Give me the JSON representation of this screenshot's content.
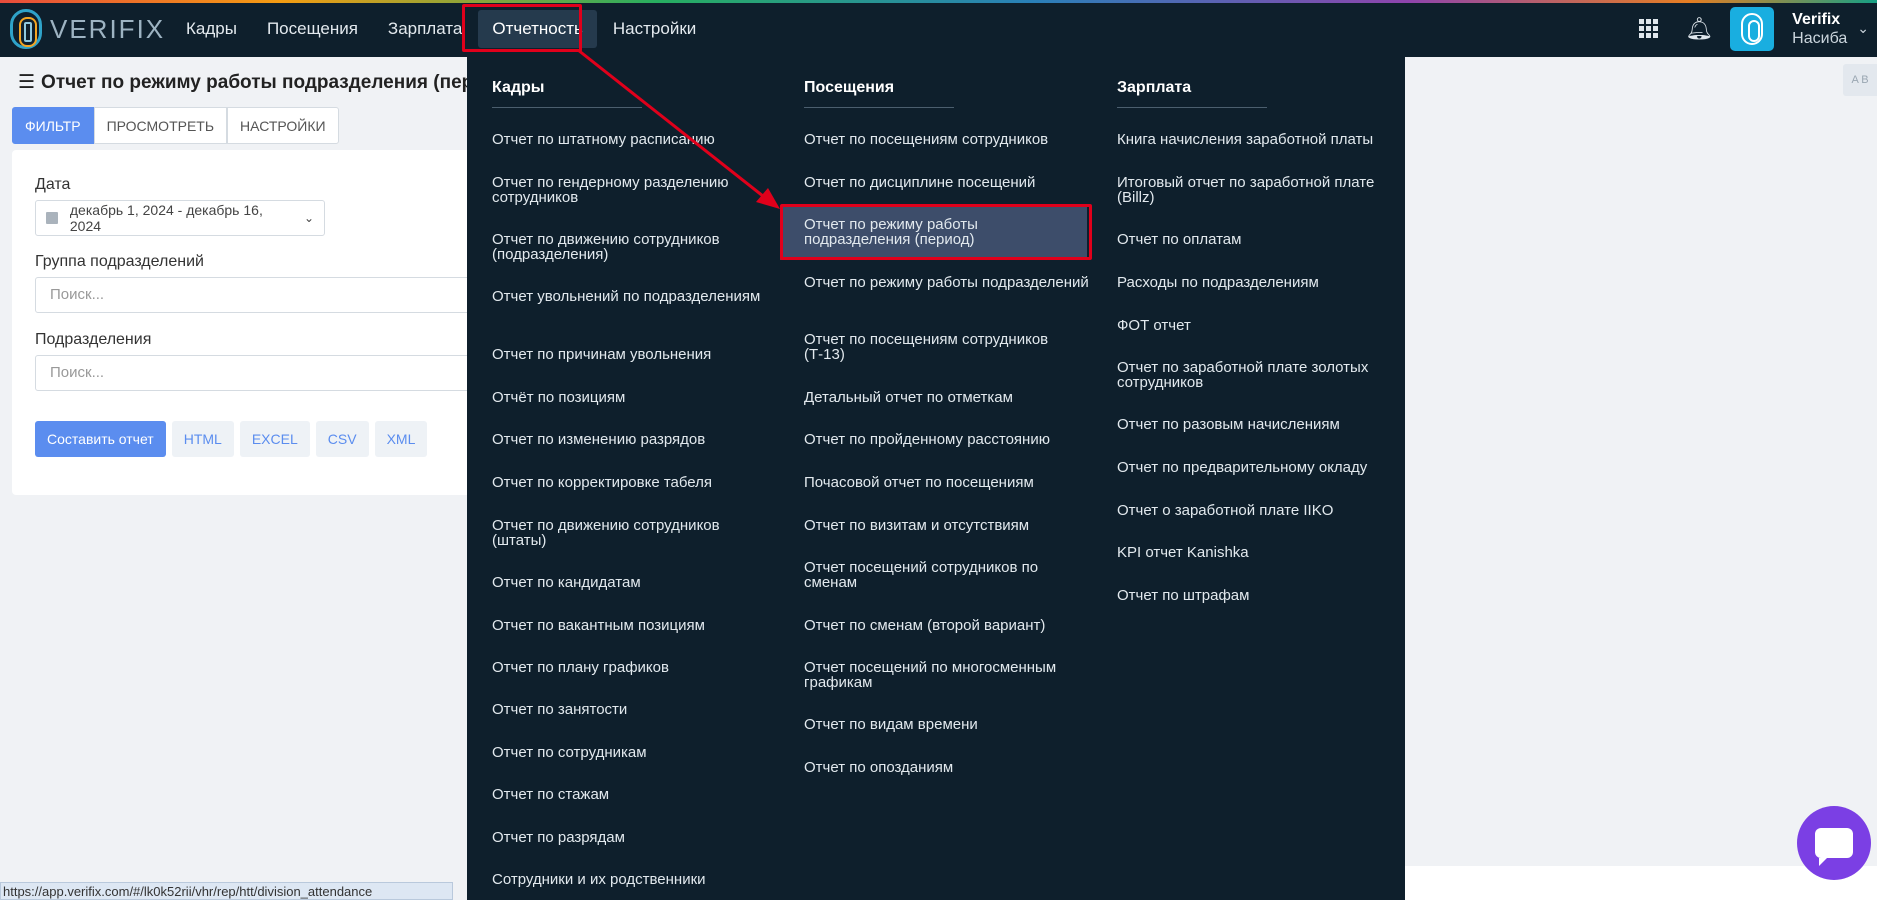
{
  "header": {
    "logo_text": "VERIFIX",
    "nav": [
      "Кадры",
      "Посещения",
      "Зарплата",
      "Отчетность",
      "Настройки"
    ],
    "user_name": "Verifix",
    "user_sub": "Насиба"
  },
  "page": {
    "title": "Отчет по режиму работы подразделения (перио",
    "tabs": [
      "ФИЛЬТР",
      "ПРОСМОТРЕТЬ",
      "НАСТРОЙКИ"
    ],
    "side_tag": "A B"
  },
  "filter": {
    "date_label": "Дата",
    "date_value": "декабрь 1, 2024 - декабрь 16, 2024",
    "group_label": "Группа подразделений",
    "group_placeholder": "Поиск...",
    "division_label": "Подразделения",
    "division_placeholder": "Поиск...",
    "buttons": [
      "Составить отчет",
      "HTML",
      "EXCEL",
      "CSV",
      "XML"
    ]
  },
  "menu": {
    "columns": [
      {
        "title": "Кадры",
        "items": [
          "Отчет по штатному расписанию",
          "Отчет по гендерному разделению сотрудников",
          "Отчет по движению сотрудников (подразделения)",
          "Отчет увольнений по подразделениям",
          "Отчет по причинам увольнения",
          "Отчёт по позициям",
          "Отчет по изменению разрядов",
          "Отчет по корректировке табеля",
          "Отчет по движению сотрудников (штаты)",
          "Отчет по кандидатам",
          "Отчет по вакантным позициям",
          "Отчет по плану графиков",
          "Отчет по занятости",
          "Отчет по сотрудникам",
          "Отчет по стажам",
          "Отчет по разрядам",
          "Сотрудники и их родственники"
        ]
      },
      {
        "title": "Посещения",
        "items": [
          "Отчет по посещениям сотрудников",
          "Отчет по дисциплине посещений",
          "Отчет по режиму работы подразделения (период)",
          "Отчет по режиму работы подразделений",
          "Отчет по посещениям сотрудников (Т-13)",
          "Детальный отчет по отметкам",
          "Отчет по пройденному расстоянию",
          "Почасовой отчет по посещениям",
          "Отчет по визитам и отсутствиям",
          "Отчет посещений сотрудников по сменам",
          "Отчет по сменам (второй вариант)",
          "Отчет посещений по многосменным графикам",
          "Отчет по видам времени",
          "Отчет по опозданиям"
        ]
      },
      {
        "title": "Зарплата",
        "items": [
          "Книга начисления заработной платы",
          "Итоговый отчет по заработной плате (Billz)",
          "Отчет по оплатам",
          "Расходы по подразделениям",
          "ФОТ отчет",
          "Отчет по заработной плате золотых сотрудников",
          "Отчет по разовым начислениям",
          "Отчет по предварительному окладу",
          "Отчет о заработной плате IIKO",
          "KPI отчет Kanishka",
          "Отчет по штрафам"
        ]
      }
    ]
  },
  "status_url": "https://app.verifix.com/#/lk0k52rii/vhr/rep/htt/division_attendance"
}
